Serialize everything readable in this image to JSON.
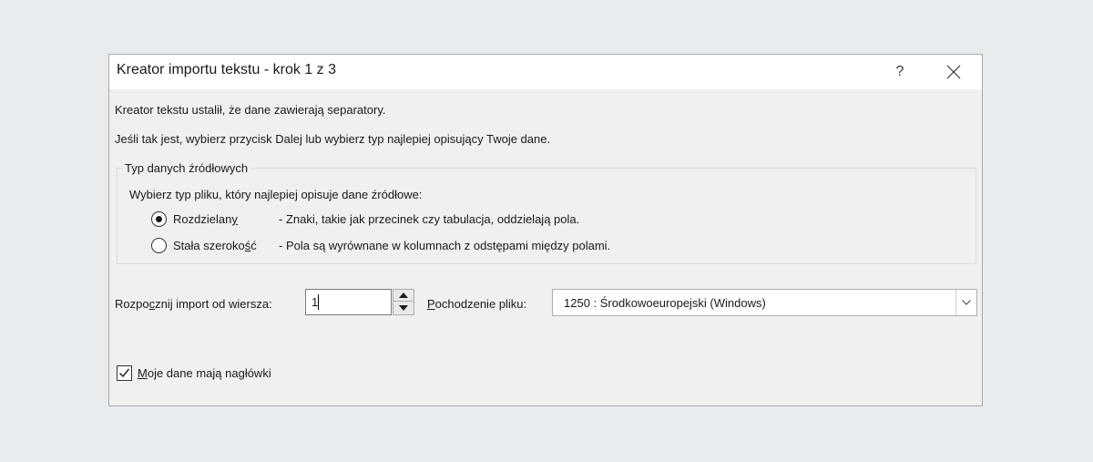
{
  "dialog": {
    "title": "Kreator importu tekstu - krok 1 z 3",
    "help_label": "?",
    "intro_line1": "Kreator tekstu ustalił, że dane zawierają separatory.",
    "intro_line2": "Jeśli tak jest, wybierz przycisk Dalej lub wybierz typ najlepiej opisujący Twoje dane."
  },
  "source_type": {
    "legend": "Typ danych źródłowych",
    "prompt": "Wybierz typ pliku, który najlepiej opisuje dane źródłowe:",
    "options": [
      {
        "label_main": "Rozdzielan",
        "label_key": "y",
        "label_tail": "",
        "description": "- Znaki, takie jak przecinek czy tabulacja, oddzielają pola.",
        "selected": true
      },
      {
        "label_main": "Stała szeroko",
        "label_key": "ś",
        "label_tail": "ć",
        "description": "- Pola są wyrównane w kolumnach z odstępami między polami.",
        "selected": false
      }
    ]
  },
  "start_row": {
    "label_pre": "Rozpo",
    "label_key": "c",
    "label_post": "znij import od wiersza:",
    "value": "1"
  },
  "file_origin": {
    "label_key": "P",
    "label_post": "ochodzenie pliku:",
    "value": "1250 : Środkowoeuropejski (Windows)"
  },
  "headers_checkbox": {
    "label_key": "M",
    "label_post": "oje dane mają nagłówki",
    "checked": true
  }
}
